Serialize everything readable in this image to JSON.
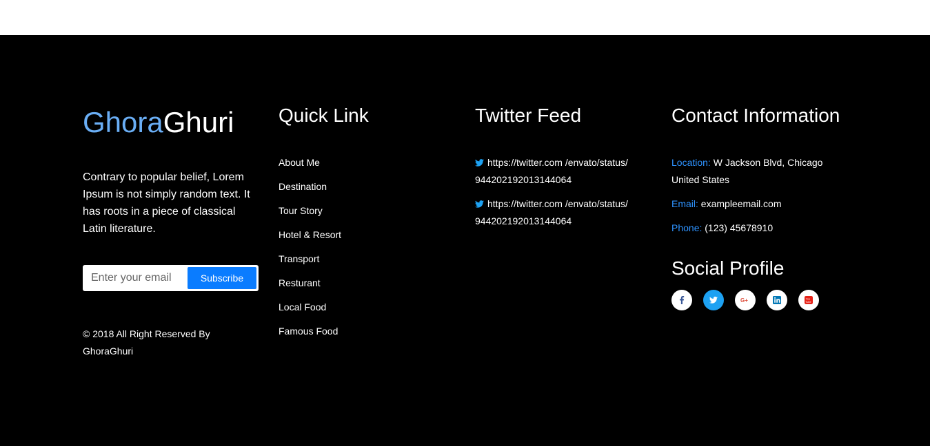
{
  "brand": {
    "part1": "Ghora",
    "part2": "Ghuri"
  },
  "about_text": "Contrary to popular belief, Lorem Ipsum is not simply random text. It has roots in a piece of classical Latin literature.",
  "subscribe": {
    "placeholder": "Enter your email",
    "button_label": "Subscribe"
  },
  "copyright": "© 2018 All Right Reserved By GhoraGhuri",
  "quick_link": {
    "heading": "Quick Link",
    "items": [
      "About Me",
      "Destination",
      "Tour Story",
      "Hotel & Resort",
      "Transport",
      "Resturant",
      "Local Food",
      "Famous Food"
    ]
  },
  "twitter": {
    "heading": "Twitter Feed",
    "tweets": [
      "https://twitter.com /envato/status/ 944202192013144064",
      "https://twitter.com /envato/status/ 944202192013144064"
    ]
  },
  "contact": {
    "heading": "Contact Information",
    "location_label": "Location:",
    "location_value": "W Jackson Blvd, Chicago United States",
    "email_label": "Email:",
    "email_value": "exampleemail.com",
    "phone_label": "Phone:",
    "phone_value": "(123) 45678910"
  },
  "social": {
    "heading": "Social Profile",
    "icons": [
      "facebook-icon",
      "twitter-icon",
      "google-plus-icon",
      "linkedin-icon",
      "youtube-icon"
    ]
  },
  "colors": {
    "accent_blue": "#0a7cff",
    "label_blue": "#2e93ff",
    "brand_light_blue": "#6aaef5",
    "twitter_blue": "#1da1f2",
    "background": "#000000"
  }
}
